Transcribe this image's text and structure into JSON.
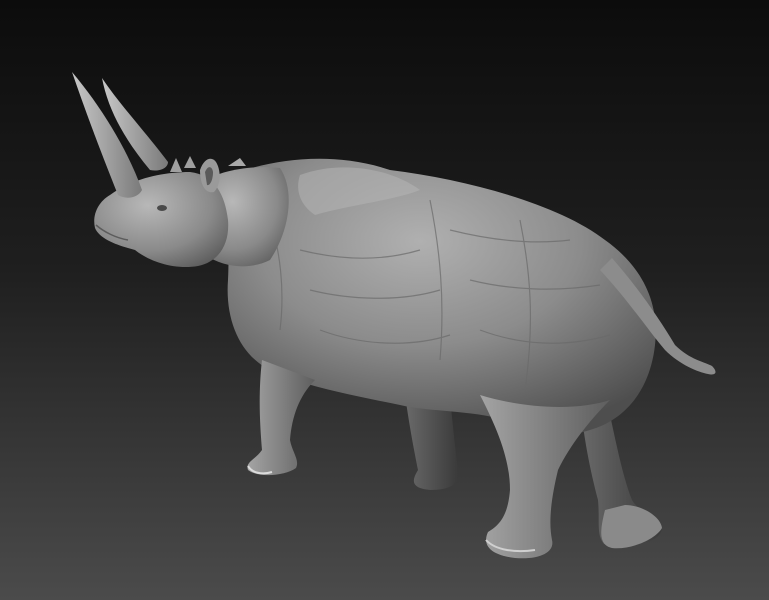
{
  "viewport": {
    "background_top": "#0d0d0d",
    "background_bottom": "#4a4a4a",
    "subject": "rhino-sculpt",
    "material_color": "#8f8f8f"
  }
}
